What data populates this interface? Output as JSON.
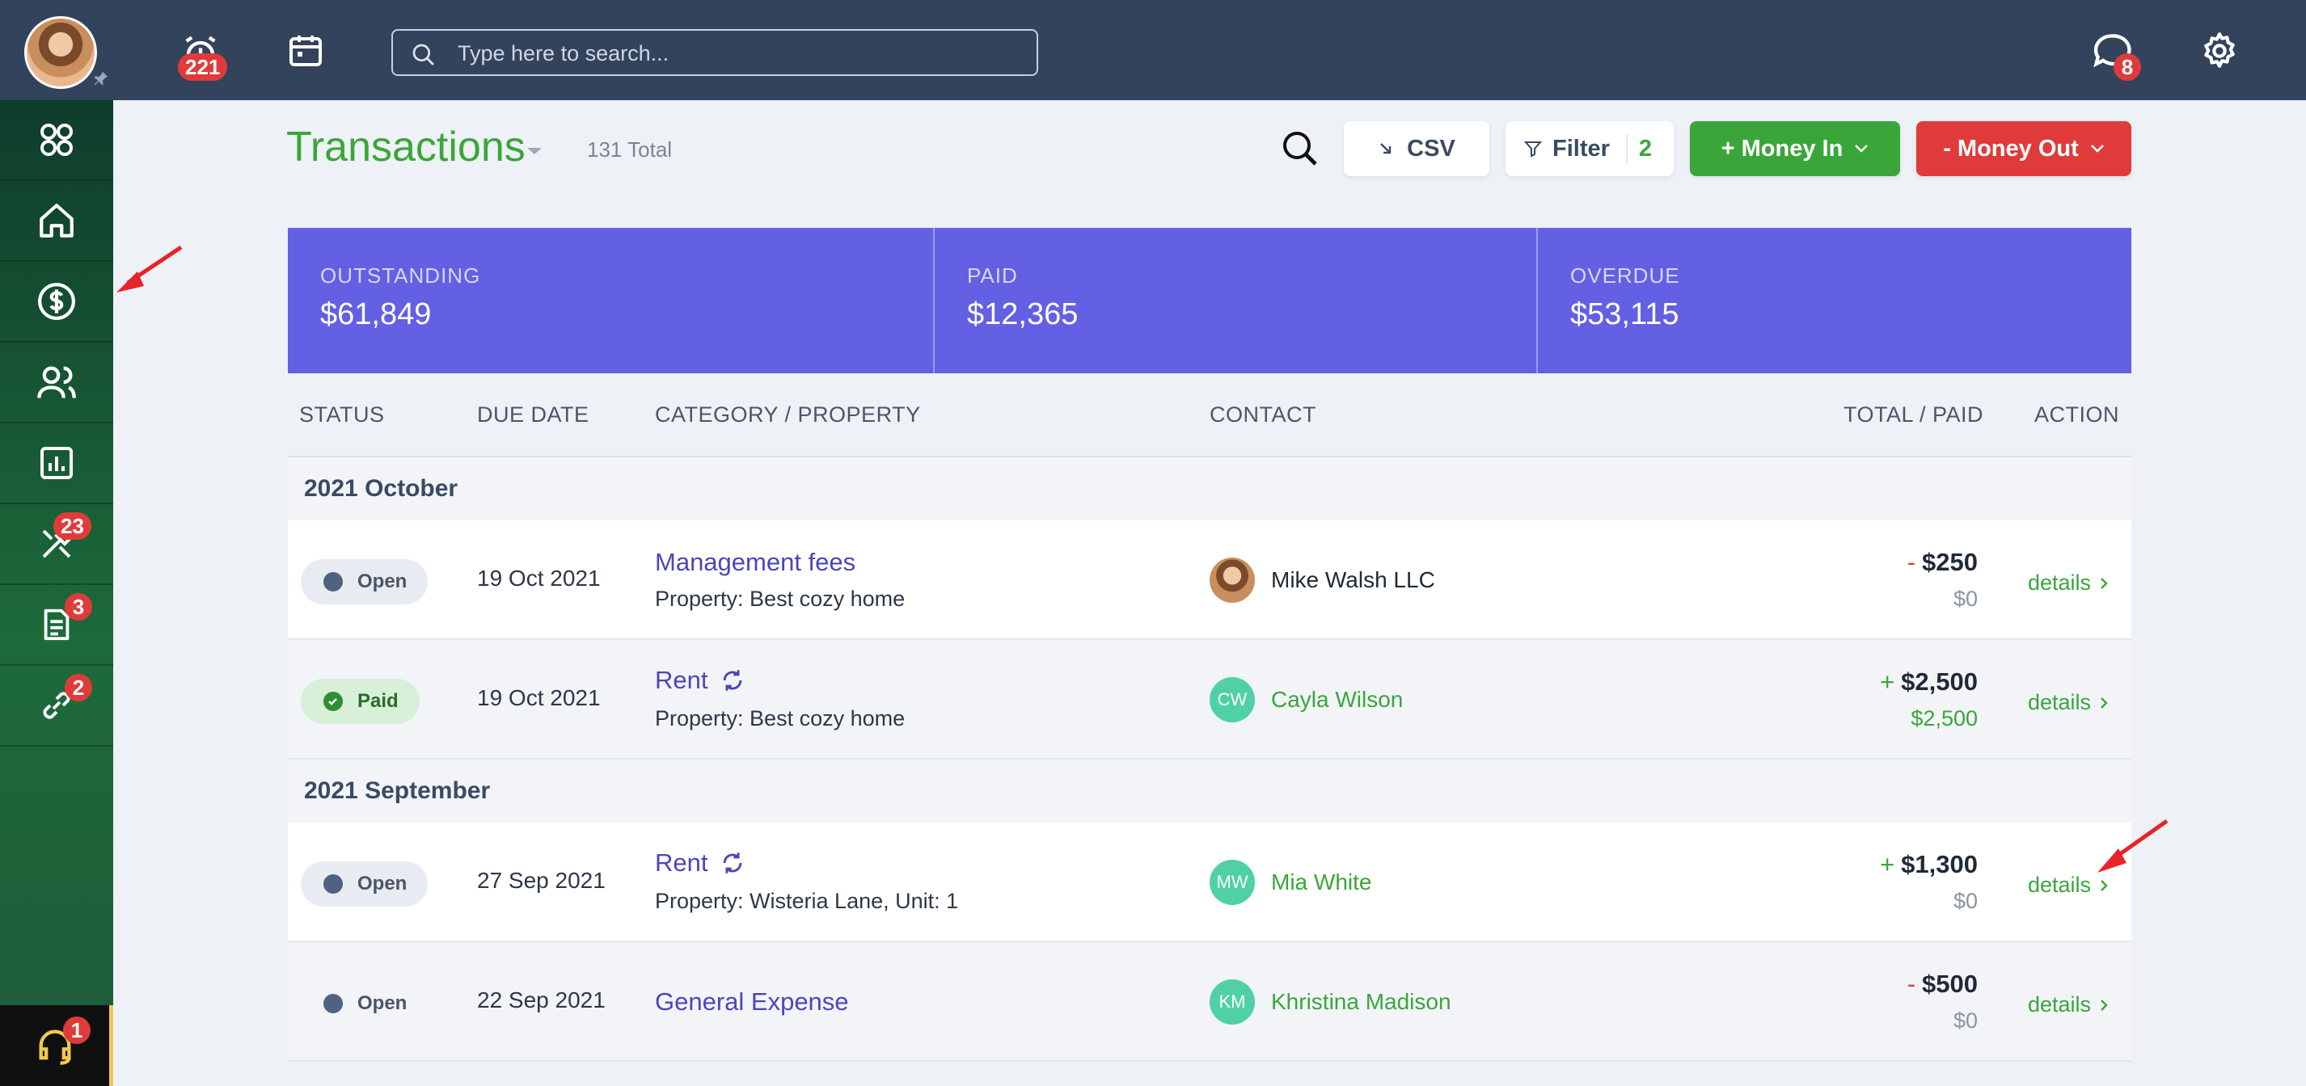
{
  "topbar": {
    "alarm_badge": "221",
    "search_placeholder": "Type here to search...",
    "chat_badge": "8"
  },
  "sidebar": {
    "items": [
      {
        "name": "apps",
        "icon": "grid-icon",
        "badge": ""
      },
      {
        "name": "home",
        "icon": "home-icon",
        "badge": ""
      },
      {
        "name": "transactions",
        "icon": "dollar-icon",
        "badge": ""
      },
      {
        "name": "contacts",
        "icon": "users-icon",
        "badge": ""
      },
      {
        "name": "reports",
        "icon": "chart-icon",
        "badge": ""
      },
      {
        "name": "maintenance",
        "icon": "tools-icon",
        "badge": "23"
      },
      {
        "name": "documents",
        "icon": "document-icon",
        "badge": "3"
      },
      {
        "name": "links",
        "icon": "link-icon",
        "badge": "2"
      }
    ],
    "help_badge": "1"
  },
  "header": {
    "title": "Transactions",
    "total": "131 Total",
    "csv_label": "CSV",
    "filter_label": "Filter",
    "filter_count": "2",
    "money_in_label": "+ Money In",
    "money_out_label": "- Money Out"
  },
  "summary": {
    "outstanding_label": "OUTSTANDING",
    "outstanding_value": "$61,849",
    "paid_label": "PAID",
    "paid_value": "$12,365",
    "overdue_label": "OVERDUE",
    "overdue_value": "$53,115"
  },
  "table": {
    "columns": {
      "status": "STATUS",
      "due_date": "DUE DATE",
      "category": "CATEGORY / PROPERTY",
      "contact": "CONTACT",
      "total": "TOTAL / PAID",
      "action": "ACTION"
    },
    "groups": [
      "2021 October",
      "2021 September"
    ],
    "rows": [
      {
        "status": "Open",
        "due": "19 Oct 2021",
        "category": "Management fees",
        "property": "Property: Best cozy home",
        "contact": "Mike Walsh LLC",
        "initials": "",
        "sign": "-",
        "total": "$250",
        "paid": "$0",
        "action": "details"
      },
      {
        "status": "Paid",
        "due": "19 Oct 2021",
        "category": "Rent",
        "property": "Property: Best cozy home",
        "contact": "Cayla Wilson",
        "initials": "CW",
        "sign": "+",
        "total": "$2,500",
        "paid": "$2,500",
        "action": "details"
      },
      {
        "status": "Open",
        "due": "27 Sep 2021",
        "category": "Rent",
        "property": "Property: Wisteria Lane, Unit: 1",
        "contact": "Mia White",
        "initials": "MW",
        "sign": "+",
        "total": "$1,300",
        "paid": "$0",
        "action": "details"
      },
      {
        "status": "Open",
        "due": "22 Sep 2021",
        "category": "General Expense",
        "property": "",
        "contact": "Khristina Madison",
        "initials": "KM",
        "sign": "-",
        "total": "$500",
        "paid": "$0",
        "action": "details"
      }
    ]
  },
  "colors": {
    "topbar": "#33435c",
    "accent_green": "#3aa63a",
    "danger_red": "#e03b3b",
    "summary_purple": "#6360e3",
    "link_purple": "#4a47b8",
    "avatar_teal": "#4fd1a5"
  }
}
